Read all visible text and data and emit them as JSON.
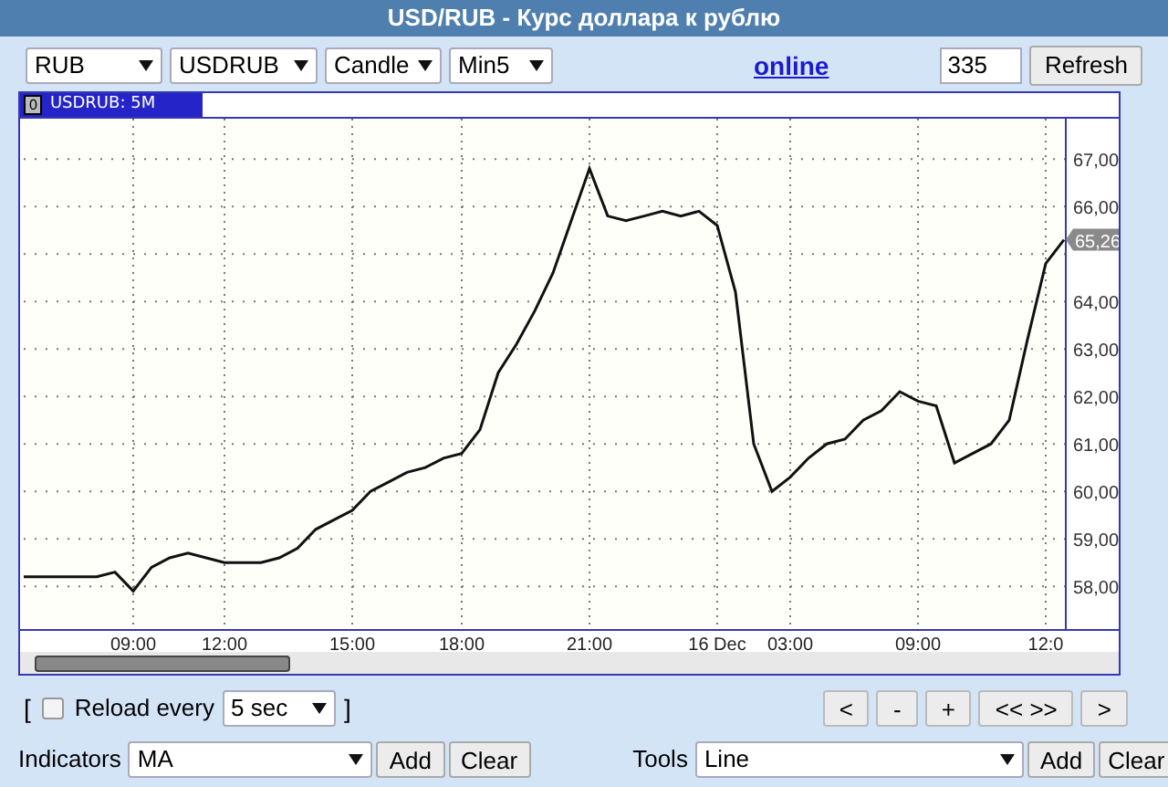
{
  "window": {
    "title": "USD/RUB - Курс доллара к рублю"
  },
  "toolbar": {
    "dropdowns": [
      "RUB",
      "USDRUB",
      "Candle",
      "Min5"
    ],
    "link": "online",
    "count": "335",
    "refresh": "Refresh"
  },
  "chart": {
    "badge": "0",
    "header": "USDRUB: 5M",
    "chart_data": {
      "type": "line",
      "categories": [
        null,
        null,
        null,
        null,
        null,
        null,
        "09:00",
        null,
        null,
        null,
        null,
        "12:00",
        null,
        null,
        null,
        null,
        null,
        null,
        "15:00",
        null,
        null,
        null,
        null,
        null,
        "18:00",
        null,
        null,
        null,
        null,
        null,
        null,
        "21:00",
        null,
        null,
        null,
        null,
        null,
        null,
        "16 Dec",
        null,
        null,
        null,
        "03:00",
        null,
        null,
        null,
        null,
        null,
        null,
        "09:00",
        null,
        null,
        null,
        null,
        null,
        null,
        "12:0",
        null
      ],
      "series": [
        {
          "color": "#111111",
          "values": [
            58.2,
            58.2,
            58.2,
            58.2,
            58.2,
            58.3,
            57.9,
            58.4,
            58.6,
            58.7,
            58.6,
            58.5,
            58.5,
            58.5,
            58.6,
            58.8,
            59.2,
            59.4,
            59.6,
            60.0,
            60.2,
            60.4,
            60.5,
            60.7,
            60.8,
            61.3,
            62.5,
            63.1,
            63.8,
            64.6,
            65.7,
            66.8,
            65.8,
            65.7,
            65.8,
            65.9,
            65.8,
            65.9,
            65.6,
            64.2,
            61.0,
            60.0,
            60.3,
            60.7,
            61.0,
            61.1,
            61.5,
            61.7,
            62.1,
            61.9,
            61.8,
            60.6,
            60.8,
            61.0,
            61.5,
            63.2,
            64.8,
            65.3
          ]
        }
      ],
      "ylim": [
        57.08,
        67.85
      ],
      "yticks": [
        {
          "value": 58,
          "label": "58,00"
        },
        {
          "value": 59,
          "label": "59,00"
        },
        {
          "value": 60,
          "label": "60,00"
        },
        {
          "value": 61,
          "label": "61,00"
        },
        {
          "value": 62,
          "label": "62,00"
        },
        {
          "value": 63,
          "label": "63,00"
        },
        {
          "value": 64,
          "label": "64,00"
        },
        {
          "value": 66,
          "label": "66,00"
        },
        {
          "value": 67,
          "label": "67,00"
        }
      ],
      "annotations": [
        "65,26"
      ],
      "grid": true
    }
  },
  "reload": {
    "open_bracket": "[",
    "checked": false,
    "label": "Reload every",
    "interval": "5 sec",
    "close_bracket": "]"
  },
  "nav_buttons": [
    "<",
    "-",
    "+",
    "<< >>",
    ">"
  ],
  "indicators": {
    "label": "Indicators",
    "value": "MA",
    "add": "Add",
    "clear": "Clear"
  },
  "tools": {
    "label": "Tools",
    "value": "Line",
    "add": "Add",
    "clear": "Clear"
  }
}
